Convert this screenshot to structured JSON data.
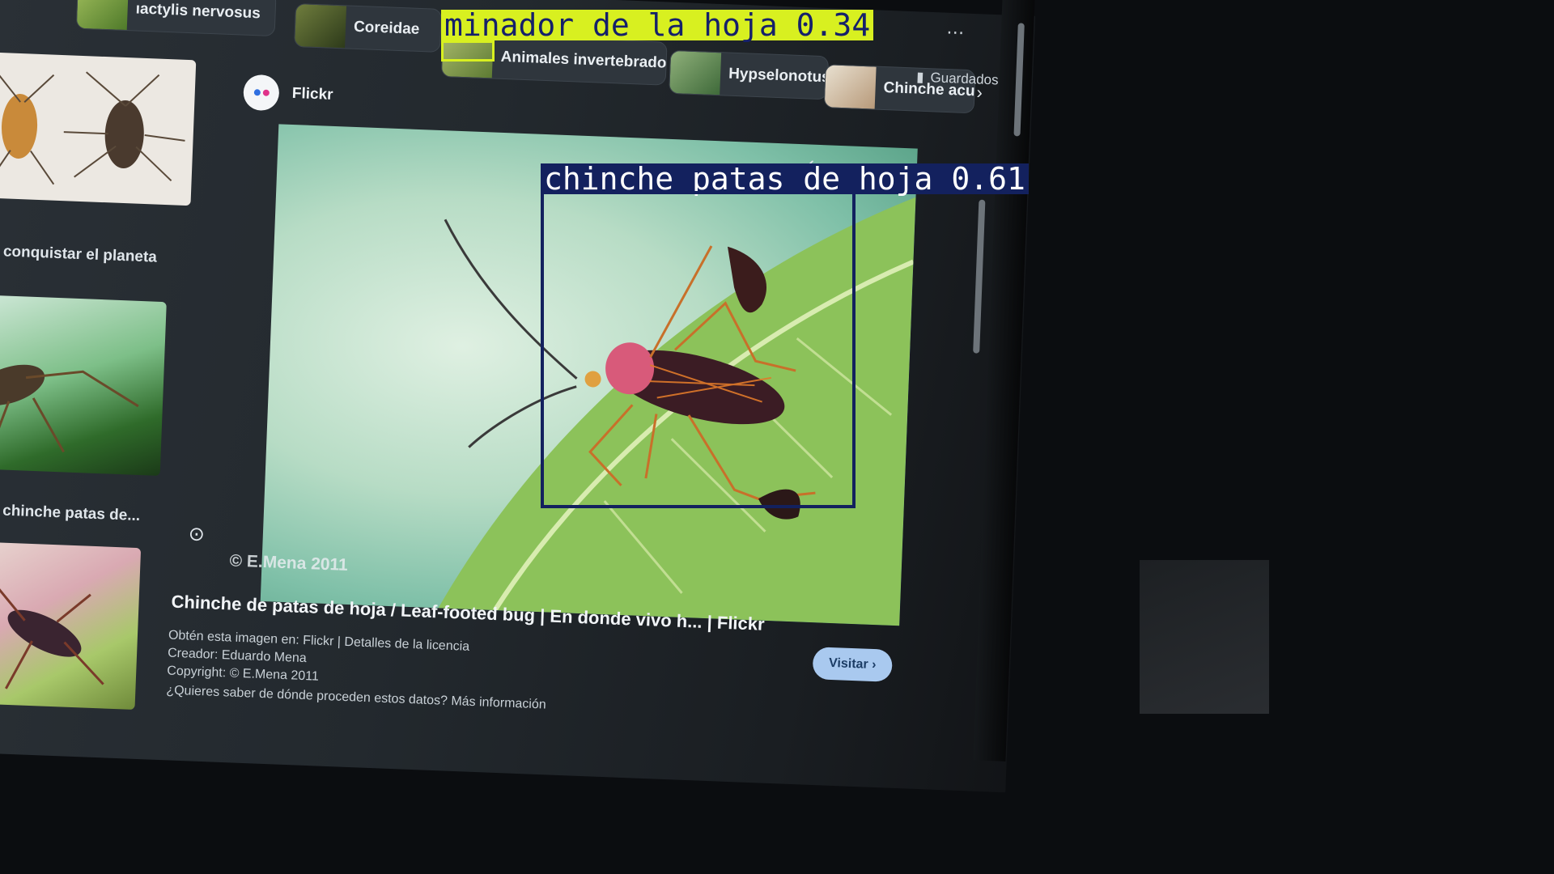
{
  "chips": [
    {
      "label": "ıactylis nervosus"
    },
    {
      "label": "Coreidae"
    },
    {
      "label": "Animales invertebrados"
    },
    {
      "label": "Hypselonotus"
    },
    {
      "label": "Chinche acua"
    }
  ],
  "saved_label": "Guardados",
  "source": {
    "name": "Flickr"
  },
  "side_captions": [
    "y conquistar el planeta",
    "an chinche patas de..."
  ],
  "photo_watermark": "© E.Mena 2011",
  "result": {
    "title": "Chinche de patas de hoja / Leaf-footed bug | En donde vivo h... | Flickr",
    "source_line": "Obtén esta imagen en: Flickr | Detalles de la licencia",
    "creator_line": "Creador: Eduardo Mena",
    "copyright_line": "Copyright: © E.Mena 2011",
    "info_line": "¿Quieres saber de dónde proceden estos datos? Más información",
    "visit_label": "Visitar ›"
  },
  "detections": [
    {
      "label": "minador de la hoja 0.34",
      "color": "#d8f020"
    },
    {
      "label": "chinche patas de hoja 0.61",
      "color": "#13215e"
    }
  ],
  "icons": [
    "bookmark-icon",
    "flickr-logo-icon",
    "visual-search-icon",
    "chevron-right-icon",
    "chevron-left-icon",
    "more-icon"
  ]
}
